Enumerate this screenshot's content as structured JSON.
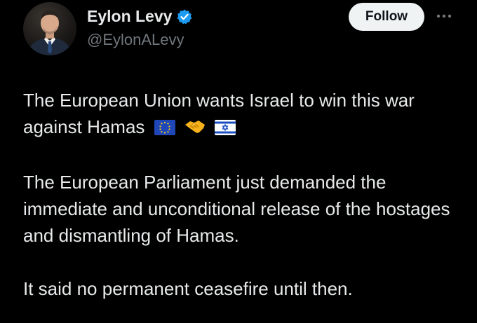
{
  "author": {
    "display_name": "Eylon Levy",
    "handle": "@EylonALevy",
    "verified": true
  },
  "actions": {
    "follow_label": "Follow",
    "more_icon": "more-horizontal-icon"
  },
  "tweet": {
    "paragraph_1": "The European Union wants Israel to win this war against Hamas",
    "paragraph_1_emoji": [
      "eu-flag",
      "handshake",
      "israel-flag"
    ],
    "paragraph_2": "The European Parliament just demanded the immediate and unconditional release of the hostages and dismantling of Hamas.",
    "paragraph_3": "It said no permanent ceasefire until then."
  },
  "colors": {
    "background": "#000000",
    "text_primary": "#e7e9ea",
    "text_secondary": "#71767b",
    "verified_blue": "#1d9bf0",
    "follow_bg": "#eff3f4"
  }
}
